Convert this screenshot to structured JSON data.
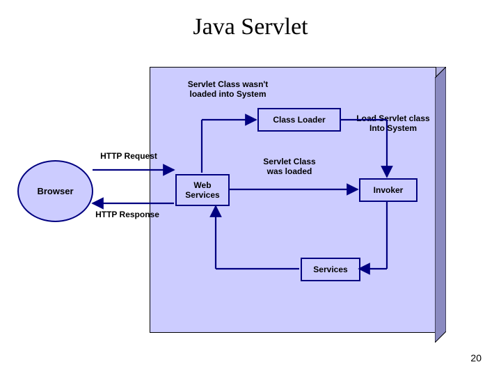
{
  "title": "Java Servlet",
  "slide_number": "20",
  "nodes": {
    "browser": "Browser",
    "class_loader": "Class Loader",
    "web_services": "Web\nServices",
    "invoker": "Invoker",
    "services": "Services"
  },
  "labels": {
    "not_loaded": "Servlet Class wasn't\nloaded into System",
    "http_request": "HTTP Request",
    "http_response": "HTTP Response",
    "was_loaded": "Servlet Class\nwas loaded",
    "load_into": "Load Servlet class\nInto System"
  }
}
